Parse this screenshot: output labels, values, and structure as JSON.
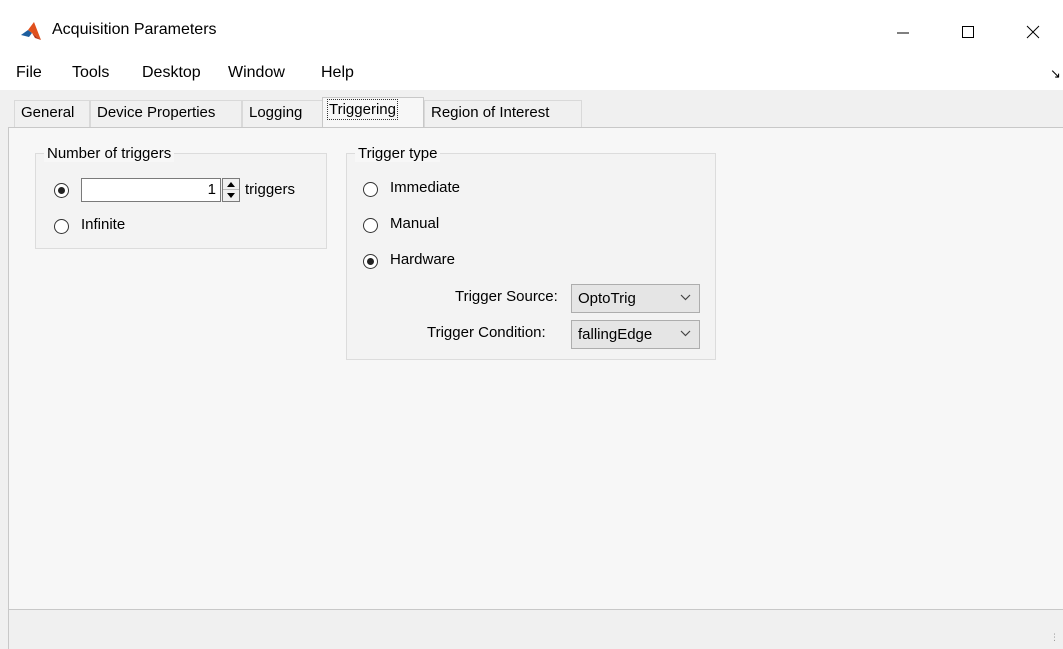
{
  "window": {
    "title": "Acquisition Parameters",
    "icon": "matlab-logo-icon",
    "controls": [
      "minimize-icon",
      "maximize-icon",
      "close-icon"
    ]
  },
  "menu": {
    "items": [
      "File",
      "Tools",
      "Desktop",
      "Window",
      "Help"
    ]
  },
  "tabs": {
    "items": [
      "General",
      "Device Properties",
      "Logging",
      "Triggering",
      "Region of Interest"
    ],
    "active": "Triggering"
  },
  "number_of_triggers": {
    "legend": "Number of triggers",
    "value": "1",
    "unit": "triggers",
    "infinite_label": "Infinite",
    "selected": "count"
  },
  "trigger_type": {
    "legend": "Trigger type",
    "options": [
      "Immediate",
      "Manual",
      "Hardware"
    ],
    "selected": "Hardware",
    "source_label": "Trigger Source:",
    "source_value": "OptoTrig",
    "condition_label": "Trigger Condition:",
    "condition_value": "fallingEdge"
  },
  "colors": {
    "accent_logo": "#e0501c"
  }
}
